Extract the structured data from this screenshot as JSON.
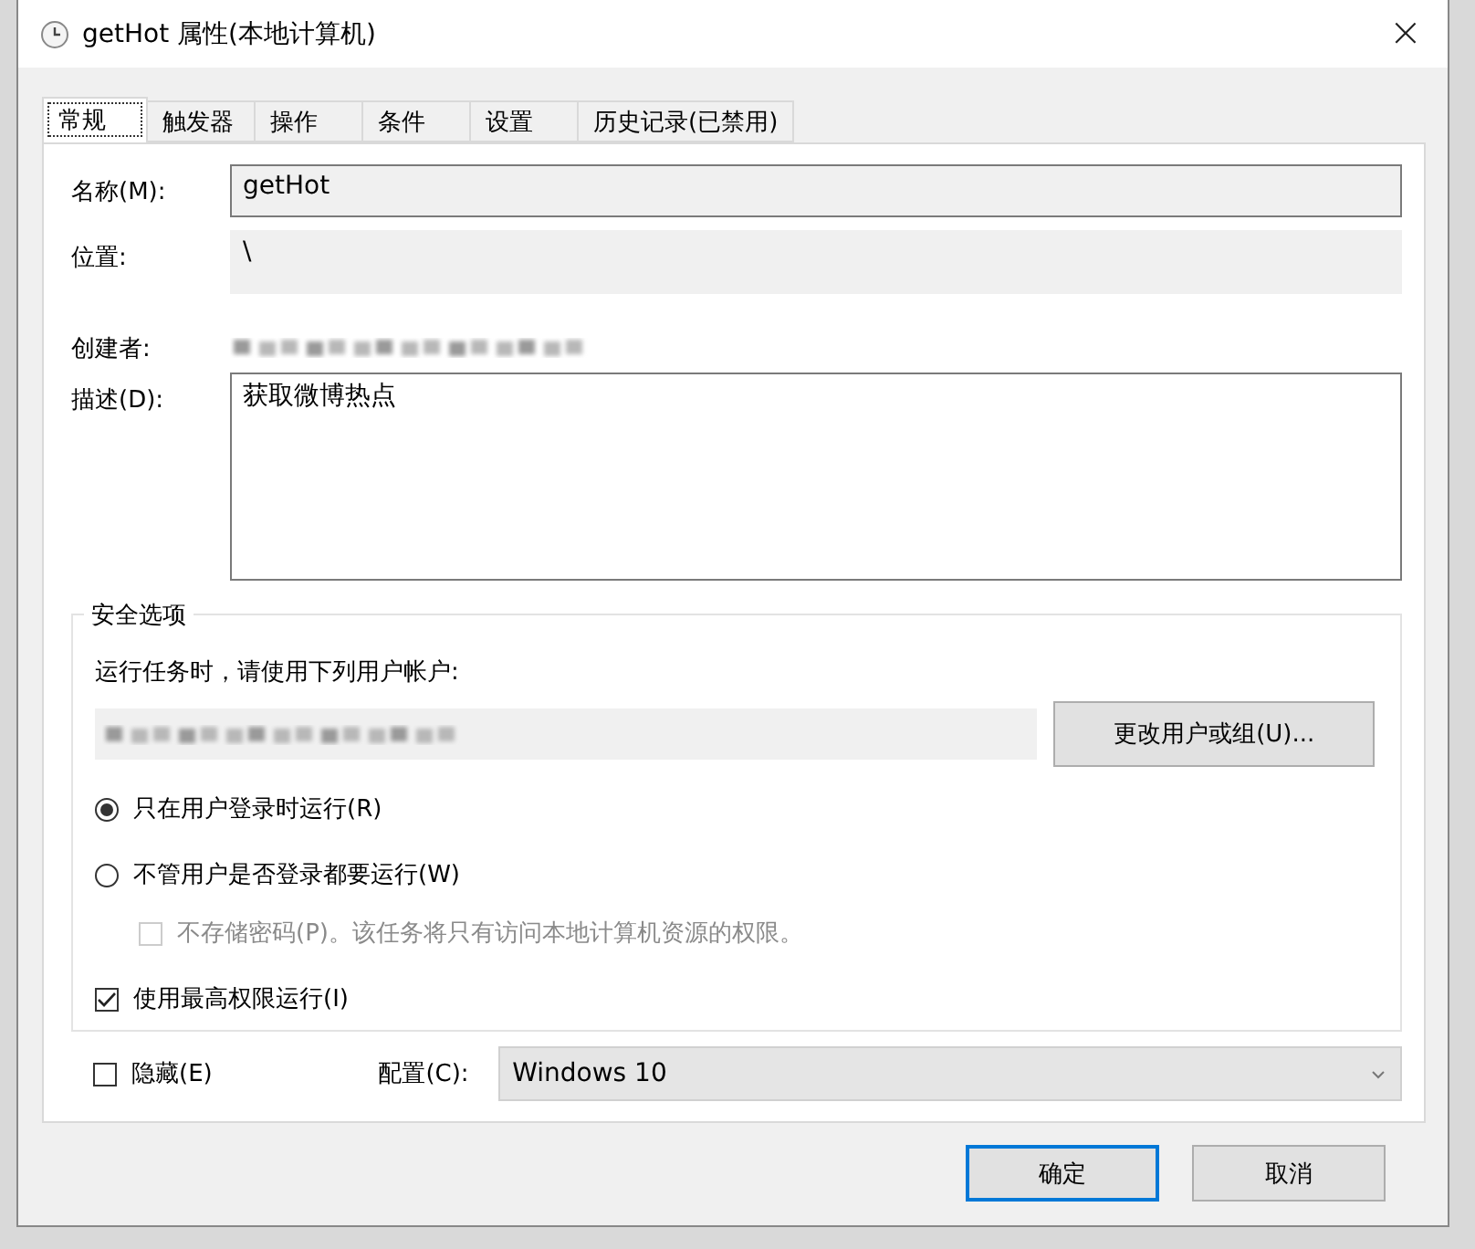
{
  "window": {
    "title": "getHot 属性(本地计算机)",
    "close": "×"
  },
  "tabs": [
    {
      "label": "常规",
      "selected": true
    },
    {
      "label": "触发器",
      "selected": false
    },
    {
      "label": "操作",
      "selected": false
    },
    {
      "label": "条件",
      "selected": false
    },
    {
      "label": "设置",
      "selected": false
    },
    {
      "label": "历史记录(已禁用)",
      "selected": false
    }
  ],
  "general": {
    "name_label": "名称(M):",
    "name_value": "getHot",
    "location_label": "位置:",
    "location_value": "\\",
    "author_label": "创建者:",
    "description_label": "描述(D):",
    "description_value": "获取微博热点"
  },
  "security": {
    "title": "安全选项",
    "account_prompt": "运行任务时，请使用下列用户帐户:",
    "change_user_button": "更改用户或组(U)...",
    "options": [
      {
        "kind": "radio",
        "label": "只在用户登录时运行(R)",
        "selected": true,
        "disabled": false
      },
      {
        "kind": "radio",
        "label": "不管用户是否登录都要运行(W)",
        "selected": false,
        "disabled": false
      },
      {
        "kind": "checkbox",
        "label": "不存储密码(P)。该任务将只有访问本地计算机资源的权限。",
        "checked": false,
        "disabled": true
      },
      {
        "kind": "checkbox",
        "label": "使用最高权限运行(I)",
        "checked": true,
        "disabled": false
      }
    ]
  },
  "hidden": {
    "label": "隐藏(E)",
    "checked": false
  },
  "configure": {
    "label": "配置(C):",
    "value": "Windows 10"
  },
  "buttons": [
    {
      "label": "确定",
      "default": true
    },
    {
      "label": "取消",
      "default": false
    }
  ]
}
